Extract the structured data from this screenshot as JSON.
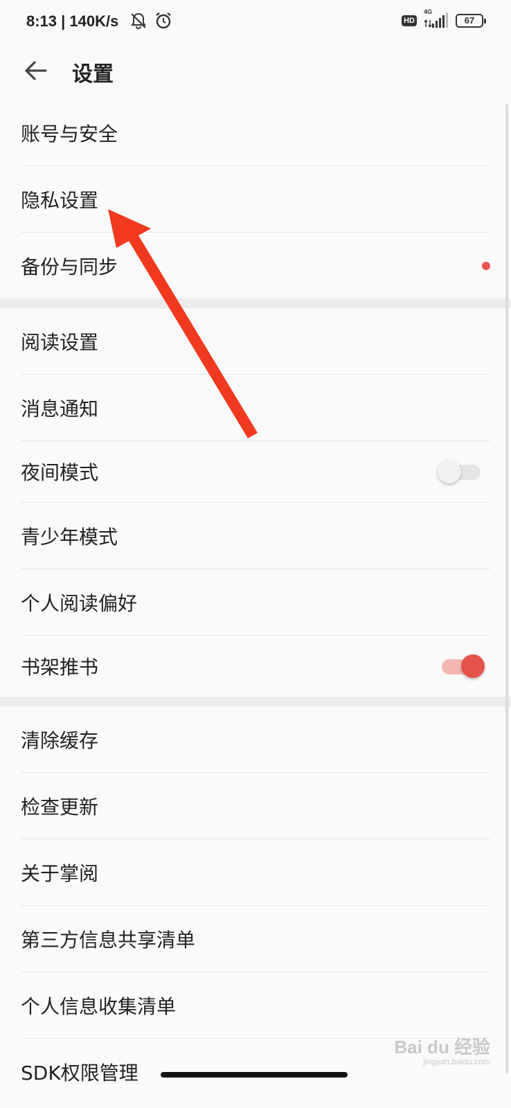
{
  "status_bar": {
    "time_and_speed": "8:13 | 140K/s",
    "network": "4G",
    "hd_badge": "HD",
    "battery": "67"
  },
  "header": {
    "title": "设置",
    "back_icon": "arrow-left-icon"
  },
  "groups": [
    {
      "items": [
        {
          "label": "账号与安全"
        },
        {
          "label": "隐私设置"
        },
        {
          "label": "备份与同步",
          "badge": "red-dot"
        }
      ]
    },
    {
      "items": [
        {
          "label": "阅读设置"
        },
        {
          "label": "消息通知"
        },
        {
          "label": "夜间模式",
          "toggle": false
        },
        {
          "label": "青少年模式"
        },
        {
          "label": "个人阅读偏好"
        },
        {
          "label": "书架推书",
          "toggle": true
        }
      ]
    },
    {
      "items": [
        {
          "label": "清除缓存"
        },
        {
          "label": "检查更新"
        },
        {
          "label": "关于掌阅"
        },
        {
          "label": "第三方信息共享清单"
        },
        {
          "label": "个人信息收集清单"
        },
        {
          "label": "SDK权限管理"
        }
      ]
    }
  ],
  "colors": {
    "accent": "#e5534b",
    "annotation_arrow": "#f0391f",
    "background": "#fafafa",
    "divider": "#ececec"
  },
  "watermark": {
    "brand": "Bai du 经验",
    "url": "jingyan.baidu.com"
  }
}
